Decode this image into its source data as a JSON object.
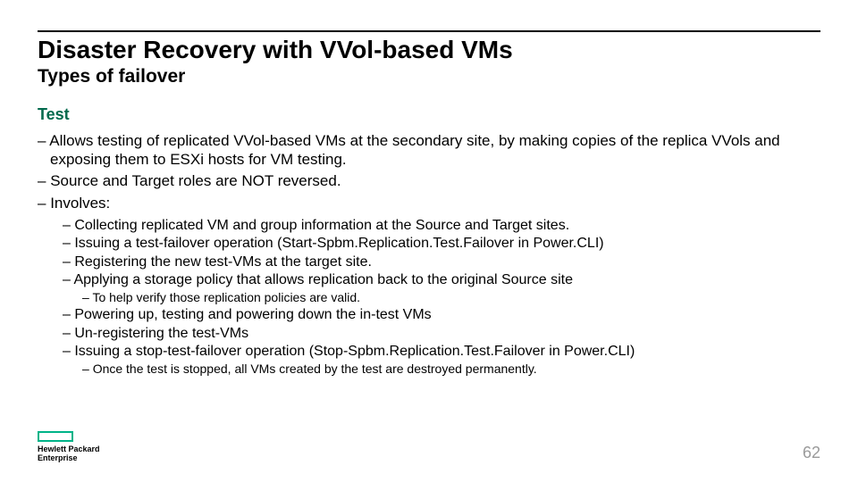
{
  "title": "Disaster Recovery with VVol-based VMs",
  "subtitle": "Types of failover",
  "section": "Test",
  "bullets": {
    "b1": "Allows testing of replicated VVol-based VMs at the secondary site, by making copies of the replica VVols and exposing them to ESXi hosts for VM testing.",
    "b2": "Source and Target roles are NOT reversed.",
    "b3": "Involves:",
    "b3a": "Collecting replicated VM and group information at the Source and Target sites.",
    "b3b": "Issuing a test-failover operation (Start-Spbm.Replication.Test.Failover in Power.CLI)",
    "b3c": "Registering the new test-VMs at the target site.",
    "b3d": "Applying a storage policy that allows replication back to the original Source site",
    "b3d1": "To help verify those replication policies are valid.",
    "b3e": "Powering up, testing and powering down the in-test VMs",
    "b3f": "Un-registering the test-VMs",
    "b3g": "Issuing a stop-test-failover operation (Stop-Spbm.Replication.Test.Failover in Power.CLI)",
    "b3g1": "Once the test is stopped, all VMs created by the test are destroyed permanently."
  },
  "footer": {
    "line1": "Hewlett Packard",
    "line2": "Enterprise"
  },
  "page": "62"
}
